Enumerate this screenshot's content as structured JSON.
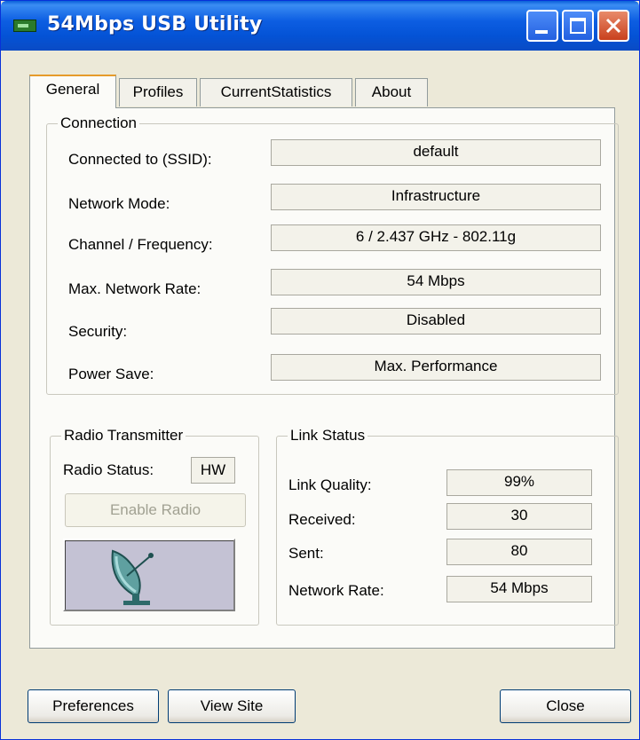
{
  "window": {
    "title": "54Mbps USB Utility"
  },
  "tabs": [
    {
      "label": "General",
      "active": true
    },
    {
      "label": "Profiles",
      "active": false
    },
    {
      "label": "CurrentStatistics",
      "active": false
    },
    {
      "label": "About",
      "active": false
    }
  ],
  "connection": {
    "title": "Connection",
    "rows": [
      {
        "label": "Connected to (SSID):",
        "value": "default"
      },
      {
        "label": "Network Mode:",
        "value": "Infrastructure"
      },
      {
        "label": "Channel / Frequency:",
        "value": "6 / 2.437 GHz - 802.11g"
      },
      {
        "label": "Max. Network Rate:",
        "value": "54 Mbps"
      },
      {
        "label": "Security:",
        "value": "Disabled"
      },
      {
        "label": "Power Save:",
        "value": "Max. Performance"
      }
    ]
  },
  "radio": {
    "title": "Radio Transmitter",
    "status_label": "Radio Status:",
    "status_value": "HW",
    "enable_button": "Enable Radio",
    "icon": "satellite-dish-icon"
  },
  "link": {
    "title": "Link Status",
    "rows": [
      {
        "label": "Link Quality:",
        "value": "99%"
      },
      {
        "label": "Received:",
        "value": "30"
      },
      {
        "label": "Sent:",
        "value": "80"
      },
      {
        "label": "Network Rate:",
        "value": "54 Mbps"
      }
    ]
  },
  "buttons": {
    "preferences": "Preferences",
    "view_site": "View Site",
    "close": "Close"
  },
  "colors": {
    "titlebar": "#0453d6",
    "window_bg": "#ece9d8",
    "close_button": "#c9401d",
    "active_tab_accent": "#e69b2b"
  }
}
